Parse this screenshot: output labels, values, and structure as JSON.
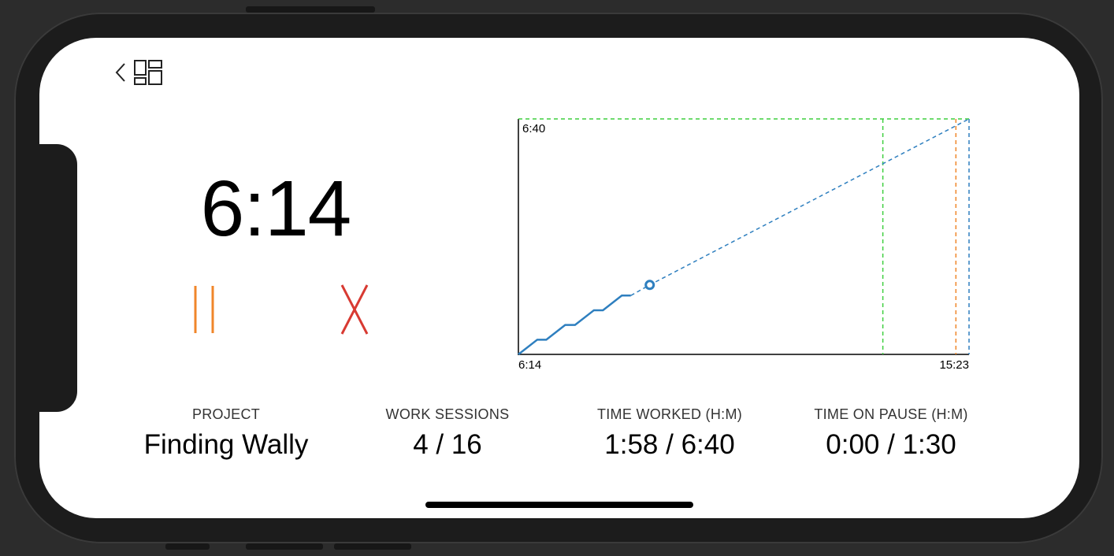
{
  "timer": {
    "elapsed": "6:14"
  },
  "controls": {
    "pause_icon": "pause-icon",
    "cancel_icon": "close-icon",
    "pause_color": "#f0862a",
    "cancel_color": "#d83a32"
  },
  "nav": {
    "back_icon": "chevron-left-icon",
    "dashboard_icon": "dashboard-icon"
  },
  "chart_data": {
    "type": "line",
    "y_top_label": "6:40",
    "x_start_label": "6:14",
    "x_end_label": "15:23",
    "x_range_minutes": [
      0,
      549
    ],
    "y_range_minutes": [
      0,
      400
    ],
    "series": [
      {
        "style": "solid",
        "color": "#2e7fbf",
        "points": [
          [
            0,
            0
          ],
          [
            23,
            25
          ],
          [
            34,
            25
          ],
          [
            57,
            50
          ],
          [
            69,
            50
          ],
          [
            92,
            75
          ],
          [
            103,
            75
          ],
          [
            126,
            100
          ],
          [
            137,
            100
          ]
        ]
      },
      {
        "style": "dashed",
        "color": "#2e7fbf",
        "points": [
          [
            137,
            100
          ],
          [
            160,
            118
          ],
          [
            549,
            400
          ]
        ]
      }
    ],
    "current_marker": [
      160,
      118
    ],
    "target_line": {
      "y": 400,
      "color": "#3fcf3f"
    },
    "vertical_markers": [
      {
        "x": 444,
        "color": "#3fcf3f"
      },
      {
        "x": 533,
        "color": "#f0862a"
      },
      {
        "x": 549,
        "color": "#2e7fbf"
      }
    ],
    "grid": false
  },
  "stats": [
    {
      "label": "PROJECT",
      "value": "Finding Wally"
    },
    {
      "label": "WORK SESSIONS",
      "value": "4 / 16"
    },
    {
      "label": "TIME WORKED (H:M)",
      "value": "1:58 / 6:40"
    },
    {
      "label": "TIME ON PAUSE (H:M)",
      "value": "0:00 / 1:30"
    }
  ]
}
